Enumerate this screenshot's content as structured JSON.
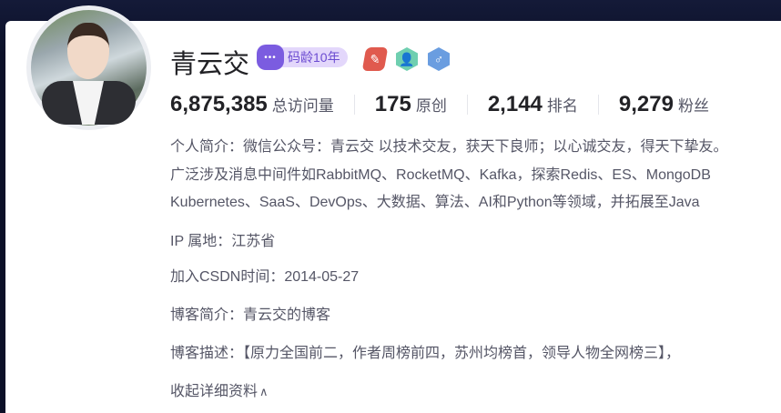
{
  "profile": {
    "name": "青云交",
    "code_age_badge": "码龄10年",
    "robot_face": "•••"
  },
  "badges": [
    {
      "icon": "quill-badge-icon",
      "color": "#e05a4e"
    },
    {
      "icon": "verified-user-badge-icon",
      "color": "#6fcfb0"
    },
    {
      "icon": "male-badge-icon",
      "color": "#6a9de0"
    }
  ],
  "stats": [
    {
      "value": "6,875,385",
      "label": "总访问量"
    },
    {
      "value": "175",
      "label": "原创"
    },
    {
      "value": "2,144",
      "label": "排名"
    },
    {
      "value": "9,279",
      "label": "粉丝"
    }
  ],
  "bio_lines": [
    "个人简介：微信公众号：青云交 以技术交友，获天下良师；以心诚交友，得天下挚友。",
    "广泛涉及消息中间件如RabbitMQ、RocketMQ、Kafka，探索Redis、ES、MongoDB",
    "Kubernetes、SaaS、DevOps、大数据、算法、AI和Python等领域，并拓展至Java"
  ],
  "ip": "IP 属地：江苏省",
  "joined": "加入CSDN时间：2014-05-27",
  "blog_intro": "博客简介：青云交的博客",
  "blog_desc": "博客描述：【原力全国前二，作者周榜前四，苏州均榜首，领导人物全网榜三】，",
  "collapse": "收起详细资料",
  "collapse_arrow": "∧"
}
